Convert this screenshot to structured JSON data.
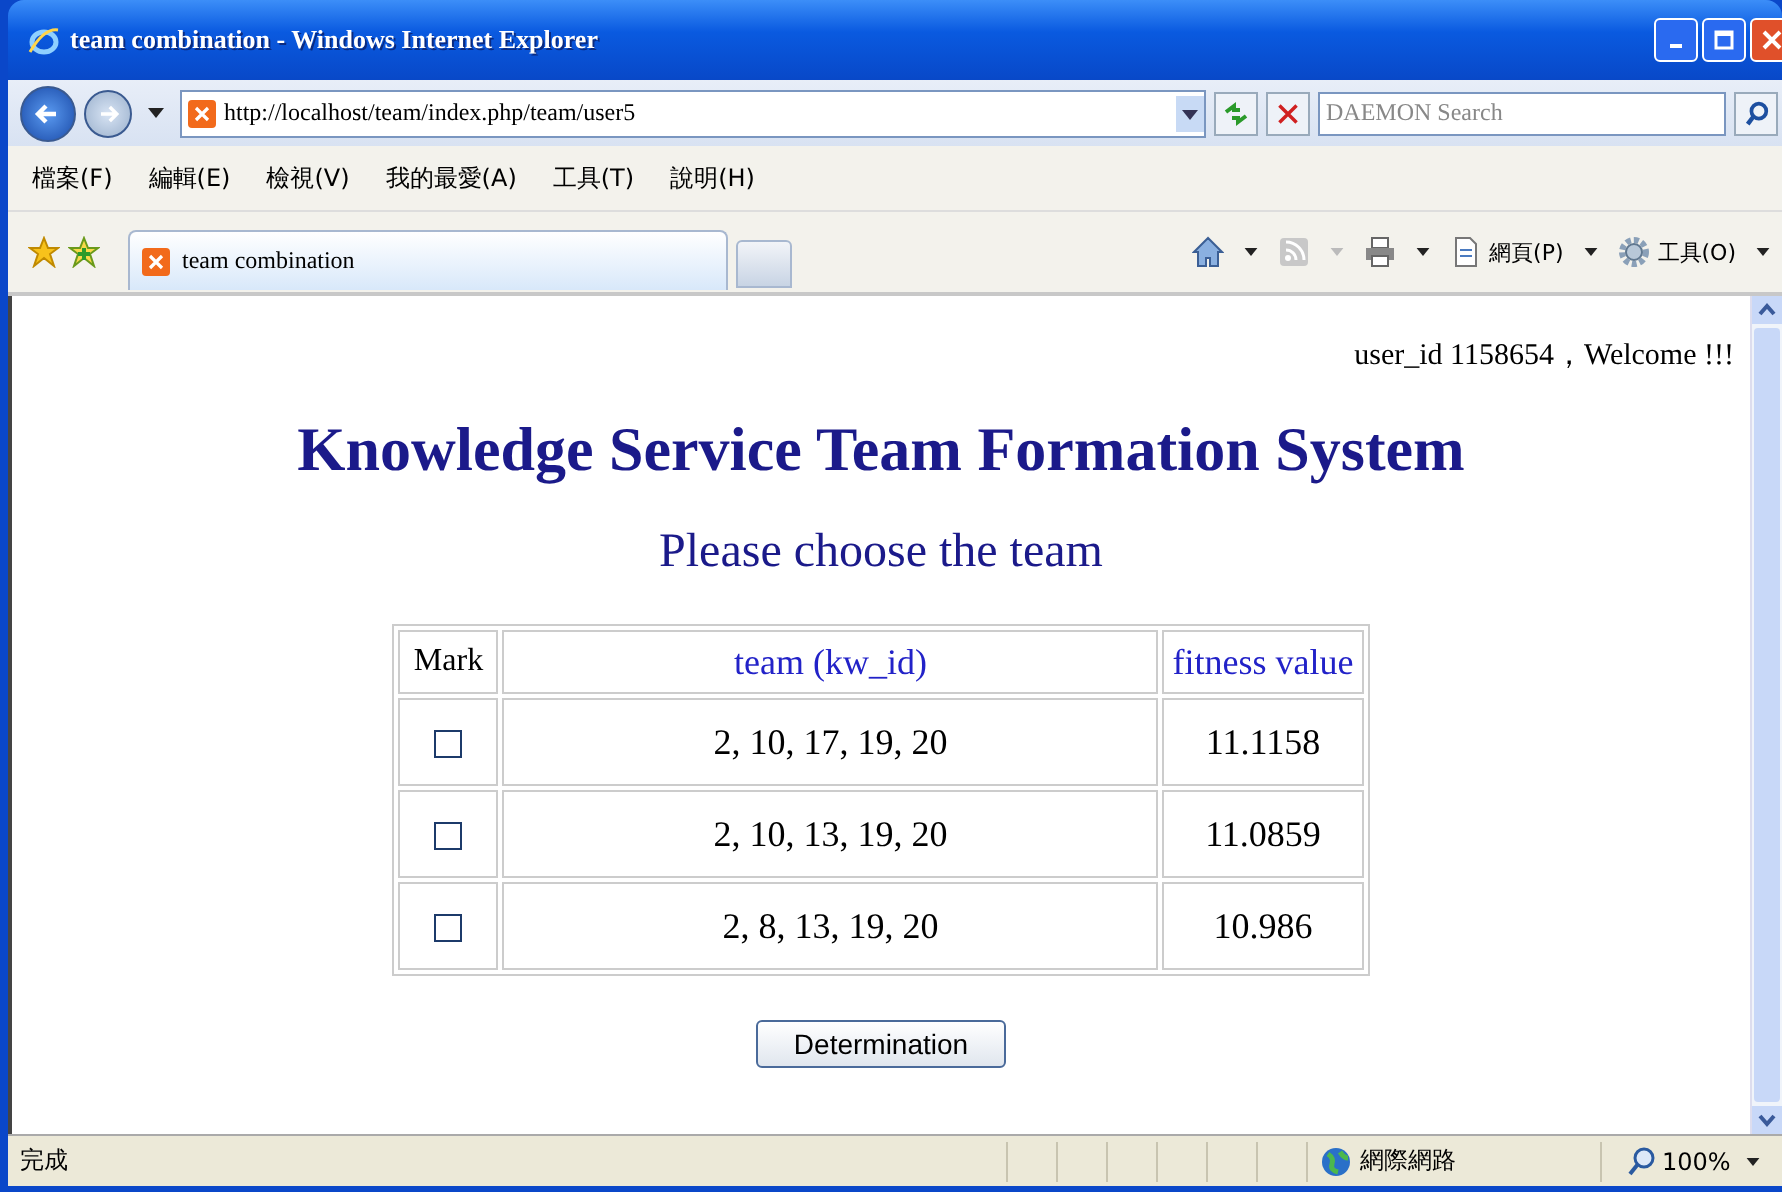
{
  "window": {
    "title": "team combination - Windows Internet Explorer"
  },
  "address_bar": {
    "url": "http://localhost/team/index.php/team/user5"
  },
  "search": {
    "placeholder": "DAEMON Search"
  },
  "menu": [
    "檔案(F)",
    "編輯(E)",
    "檢視(V)",
    "我的最愛(A)",
    "工具(T)",
    "說明(H)"
  ],
  "tabs": [
    {
      "label": "team combination",
      "selected": true
    }
  ],
  "command_bar": [
    "網頁(P)",
    "工具(O)"
  ],
  "page": {
    "greeting": "user_id 1158654，Welcome !!!",
    "heading": "Knowledge Service Team Formation System",
    "subheading": "Please choose the team",
    "table": {
      "columns": [
        "Mark",
        "team (kw_id)",
        "fitness value"
      ],
      "rows": [
        {
          "checked": false,
          "team": "2, 10, 17, 19, 20",
          "fitness": "11.1158"
        },
        {
          "checked": false,
          "team": "2, 10, 13, 19, 20",
          "fitness": "11.0859"
        },
        {
          "checked": false,
          "team": "2, 8, 13, 19, 20",
          "fitness": "10.986"
        }
      ]
    },
    "button": "Determination"
  },
  "status_bar": {
    "text": "完成",
    "zone": "網際網路",
    "zoom": "100%"
  }
}
